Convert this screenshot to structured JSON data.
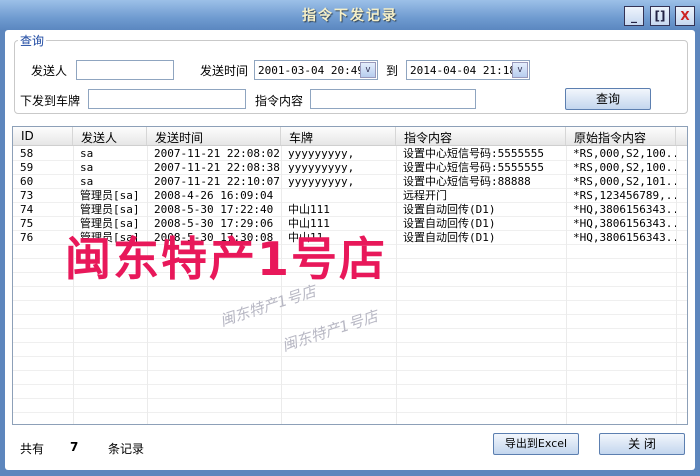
{
  "window": {
    "title": "指令下发记录",
    "minimize": "_",
    "maximize": "[]",
    "close": "X"
  },
  "query": {
    "group_label": "查询",
    "sender_label": "发送人",
    "sender_value": "",
    "time_label": "发送时间",
    "time_from": "2001-03-04 20:49",
    "to_label": "到",
    "time_to": "2014-04-04 21:18",
    "plate_label": "下发到车牌",
    "plate_value": "",
    "content_label": "指令内容",
    "content_value": "",
    "search_button": "查询"
  },
  "table": {
    "columns": [
      "ID",
      "发送人",
      "发送时间",
      "车牌",
      "指令内容",
      "原始指令内容"
    ],
    "rows": [
      [
        "58",
        "sa",
        "2007-11-21 22:08:02",
        "yyyyyyyyy,",
        "设置中心短信号码:5555555",
        "*RS,000,S2,100..."
      ],
      [
        "59",
        "sa",
        "2007-11-21 22:08:38",
        "yyyyyyyyy,",
        "设置中心短信号码:5555555",
        "*RS,000,S2,100..."
      ],
      [
        "60",
        "sa",
        "2007-11-21 22:10:07",
        "yyyyyyyyy,",
        "设置中心短信号码:88888",
        "*RS,000,S2,101..."
      ],
      [
        "73",
        "管理员[sa]",
        "2008-4-26 16:09:04",
        "",
        "远程开门",
        "*RS,123456789,..."
      ],
      [
        "74",
        "管理员[sa]",
        "2008-5-30 17:22:40",
        "中山111",
        "设置自动回传(D1)",
        "*HQ,3806156343..."
      ],
      [
        "75",
        "管理员[sa]",
        "2008-5-30 17:29:06",
        "中山111",
        "设置自动回传(D1)",
        "*HQ,3806156343..."
      ],
      [
        "76",
        "管理员[sa]",
        "2008-5-30 17:30:08",
        "中山11,",
        "设置自动回传(D1)",
        "*HQ,3806156343..."
      ]
    ]
  },
  "watermark": {
    "main": "闽东特产1号店",
    "small1": "闽东特产1号店",
    "small2": "闽东特产1号店"
  },
  "footer": {
    "total_label": "共有",
    "count": "7",
    "records_label": "条记录",
    "export_button": "导出到Excel",
    "close_button": "关 闭"
  }
}
